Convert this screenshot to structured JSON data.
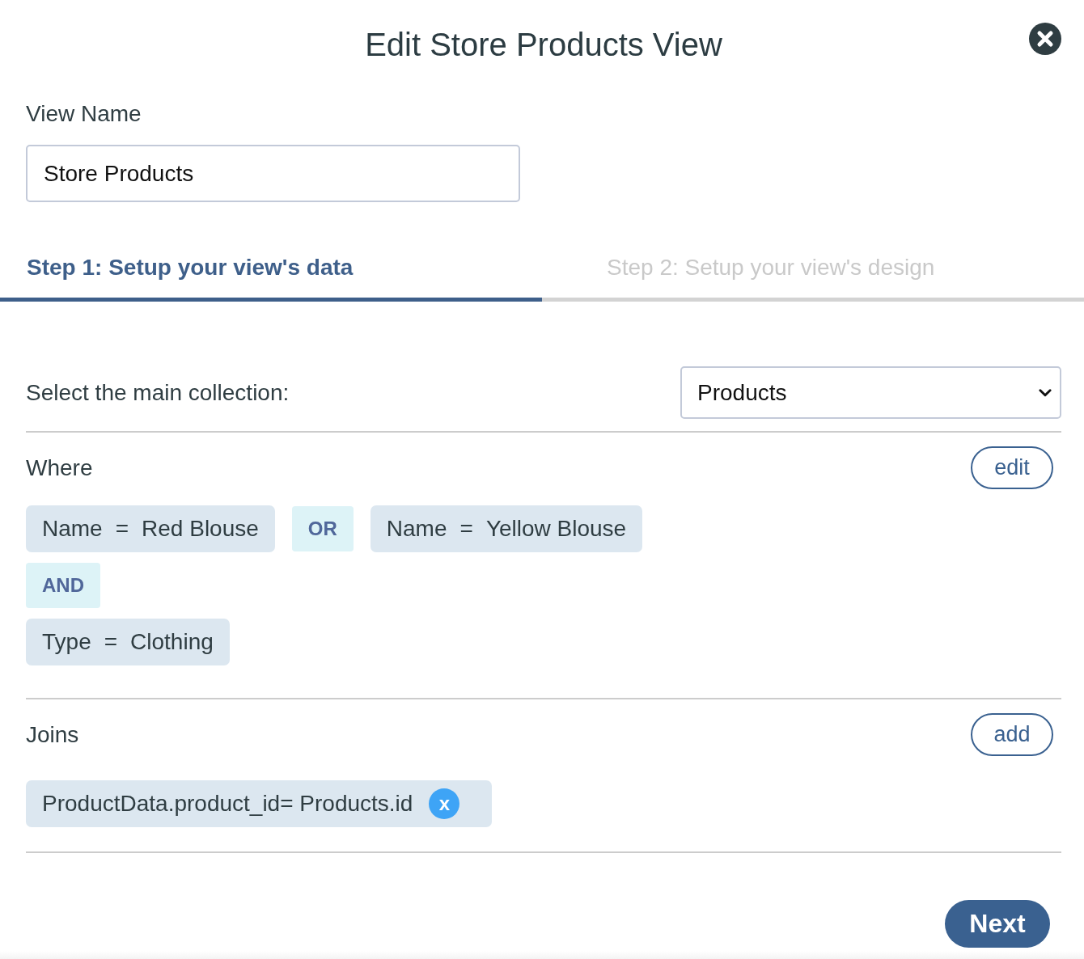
{
  "dialog": {
    "title": "Edit Store Products View"
  },
  "view_name": {
    "label": "View Name",
    "value": "Store Products"
  },
  "steps": [
    {
      "label": "Step 1: Setup your view's data",
      "selected": true
    },
    {
      "label": "Step 2: Setup your view's design",
      "selected": false
    }
  ],
  "collection": {
    "label": "Select the main collection:",
    "value": "Products"
  },
  "where": {
    "heading": "Where",
    "button": "edit",
    "rows": [
      {
        "items": [
          {
            "kind": "condition",
            "field": "Name",
            "operator": "=",
            "value": "Red Blouse"
          },
          {
            "kind": "logic",
            "text": "OR"
          },
          {
            "kind": "condition",
            "field": "Name",
            "operator": "=",
            "value": "Yellow Blouse"
          }
        ]
      },
      {
        "items": [
          {
            "kind": "logic",
            "text": "AND"
          }
        ]
      },
      {
        "items": [
          {
            "kind": "condition",
            "field": "Type",
            "operator": "=",
            "value": "Clothing"
          }
        ]
      }
    ]
  },
  "joins": {
    "heading": "Joins",
    "button": "add",
    "items": [
      {
        "text": "ProductData.product_id= Products.id",
        "remove": "x"
      }
    ]
  },
  "footer": {
    "next": "Next"
  }
}
